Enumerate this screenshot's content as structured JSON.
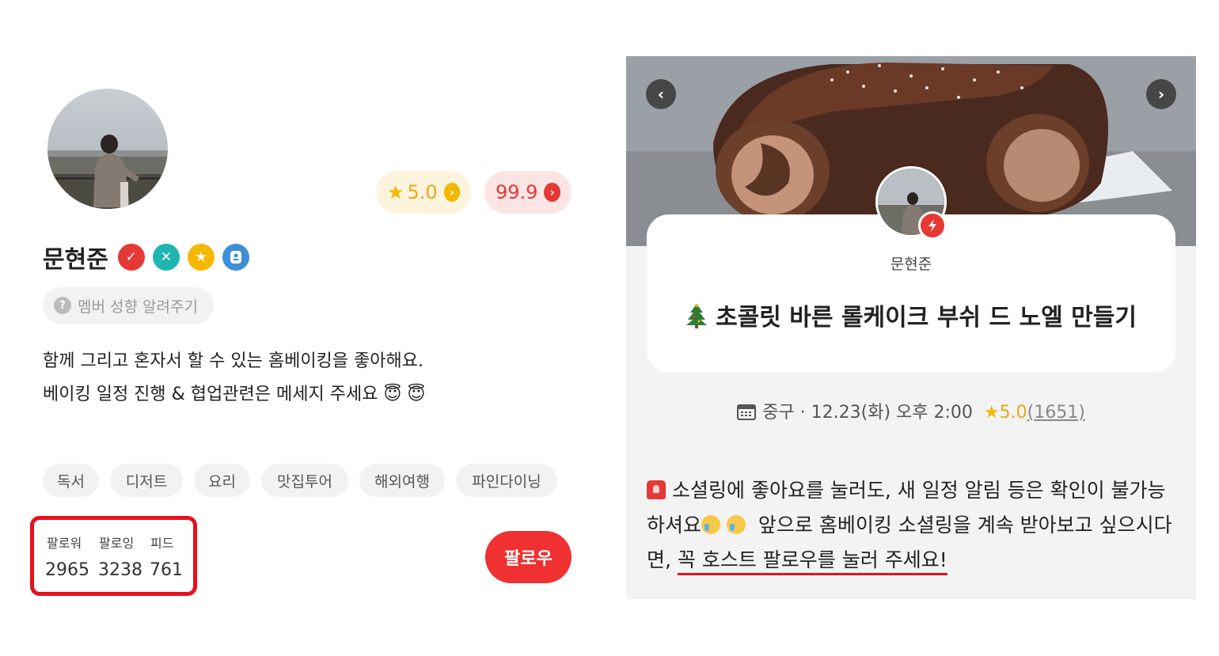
{
  "profile": {
    "name": "문현준",
    "rating_score": "5.0",
    "temperature": "99.9",
    "member_chip": "멤버 성향 알려주기",
    "bio_line1": "함께 그리고 혼자서 할 수 있는 홈베이킹을 좋아해요.",
    "bio_line2": "베이킹 일정 진행 & 협업관련은 메세지 주세요 😇 😇",
    "tags": [
      "독서",
      "디저트",
      "요리",
      "맛집투어",
      "해외여행",
      "파인다이닝"
    ],
    "stats": {
      "followers_label": "팔로워",
      "followers": "2965",
      "following_label": "팔로잉",
      "following": "3238",
      "feed_label": "피드",
      "feed": "761"
    },
    "follow_button": "팔로우",
    "badge_colors": [
      "#e53935",
      "#1fb5b0",
      "#f5b800",
      "#3d8fd6"
    ]
  },
  "event": {
    "host_name": "문현준",
    "title": "초콜릿 바른 롤케이크 부쉬 드 노엘 만들기",
    "location": "중구",
    "datetime": "12.23(화) 오후 2:00",
    "rating": "5.0",
    "rating_count": "(1651)",
    "notice_part1": "소셜링에 좋아요를 눌러도, 새 일정 알림 등은 확인이 불가능하셔요",
    "notice_part2": "앞으로 홈베이킹 소셜링을 계속 받아보고 싶으시다면,",
    "notice_emphasis": "꼭 호스트 팔로우를 눌러 주세요!",
    "accent_color": "#ef3131"
  }
}
